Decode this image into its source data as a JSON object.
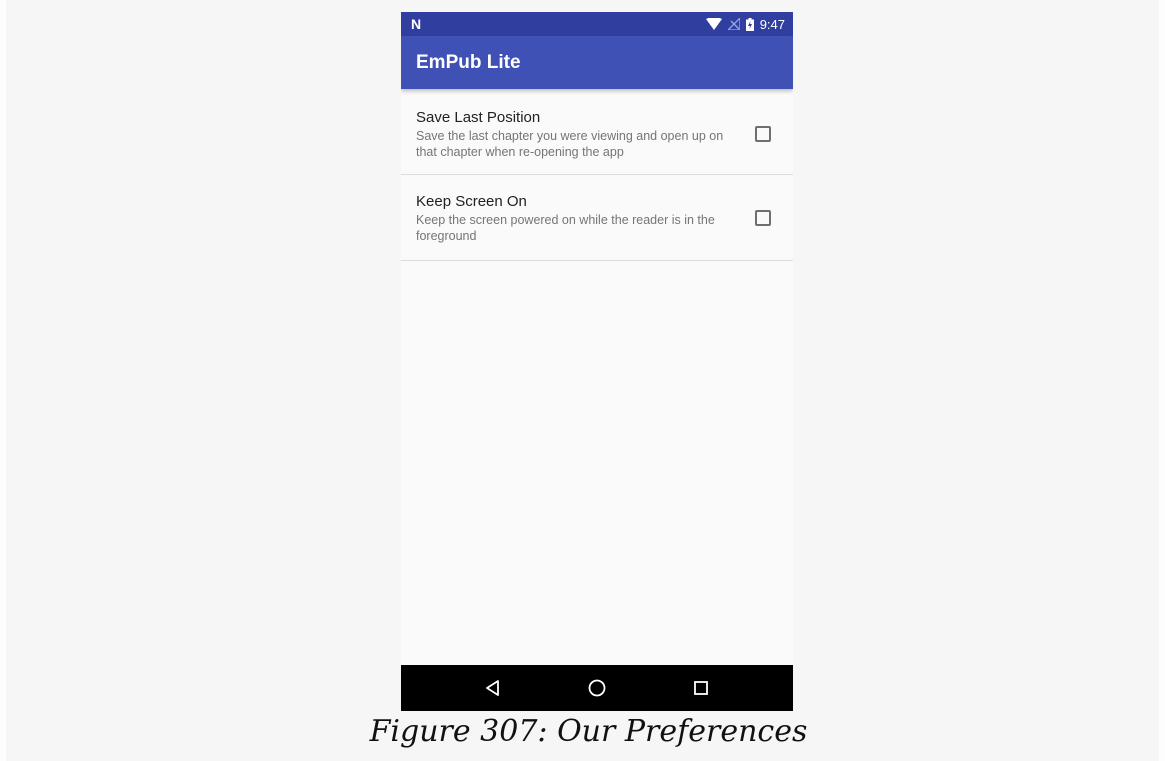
{
  "status_bar": {
    "carrier_icon": "n-logo-icon",
    "logo_text": "N",
    "time": "9:47",
    "icons": [
      "wifi-icon",
      "no-signal-icon",
      "battery-charging-icon"
    ]
  },
  "app_bar": {
    "title": "EmPub Lite"
  },
  "preferences": [
    {
      "title": "Save Last Position",
      "summary": "Save the last chapter you were viewing and open up on that chapter when re-opening the app",
      "checked": false
    },
    {
      "title": "Keep Screen On",
      "summary": "Keep the screen powered on while the reader is in the foreground",
      "checked": false
    }
  ],
  "nav_bar": {
    "buttons": [
      "back-icon",
      "home-icon",
      "recents-icon"
    ]
  },
  "caption": "Figure 307: Our Preferences",
  "colors": {
    "status_bar": "#303f9f",
    "app_bar": "#3f51b5",
    "background": "#fafafa"
  }
}
